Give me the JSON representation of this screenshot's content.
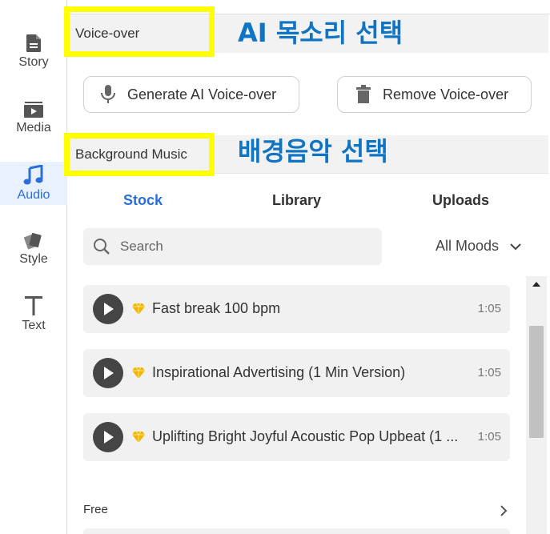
{
  "sidebar": {
    "items": [
      {
        "label": "Story",
        "icon": "document-icon"
      },
      {
        "label": "Media",
        "icon": "media-icon"
      },
      {
        "label": "Audio",
        "icon": "music-note-icon",
        "active": true
      },
      {
        "label": "Style",
        "icon": "style-icon"
      },
      {
        "label": "Text",
        "icon": "text-icon"
      }
    ]
  },
  "voiceover": {
    "header": "Voice-over",
    "generate_label": "Generate AI Voice-over",
    "remove_label": "Remove Voice-over"
  },
  "music": {
    "header": "Background Music",
    "tabs": [
      "Stock",
      "Library",
      "Uploads"
    ],
    "active_tab": "Stock",
    "search_placeholder": "Search",
    "moods_label": "All Moods",
    "tracks": [
      {
        "title": "Fast break 100 bpm",
        "duration": "1:05",
        "premium": true
      },
      {
        "title": "Inspirational Advertising (1 Min Version)",
        "duration": "1:05",
        "premium": true
      },
      {
        "title": "Uplifting Bright Joyful Acoustic Pop Upbeat (1 ...",
        "duration": "1:05",
        "premium": true
      }
    ],
    "free_label": "Free"
  },
  "annotations": {
    "voice_select": "AI 목소리 선택",
    "music_select": "배경음악 선택",
    "highlight_color": "#ffff00",
    "text_color": "#0e74c3"
  },
  "colors": {
    "accent": "#2a6edb",
    "play_button": "#454545",
    "premium_gem": "#f5b400"
  }
}
